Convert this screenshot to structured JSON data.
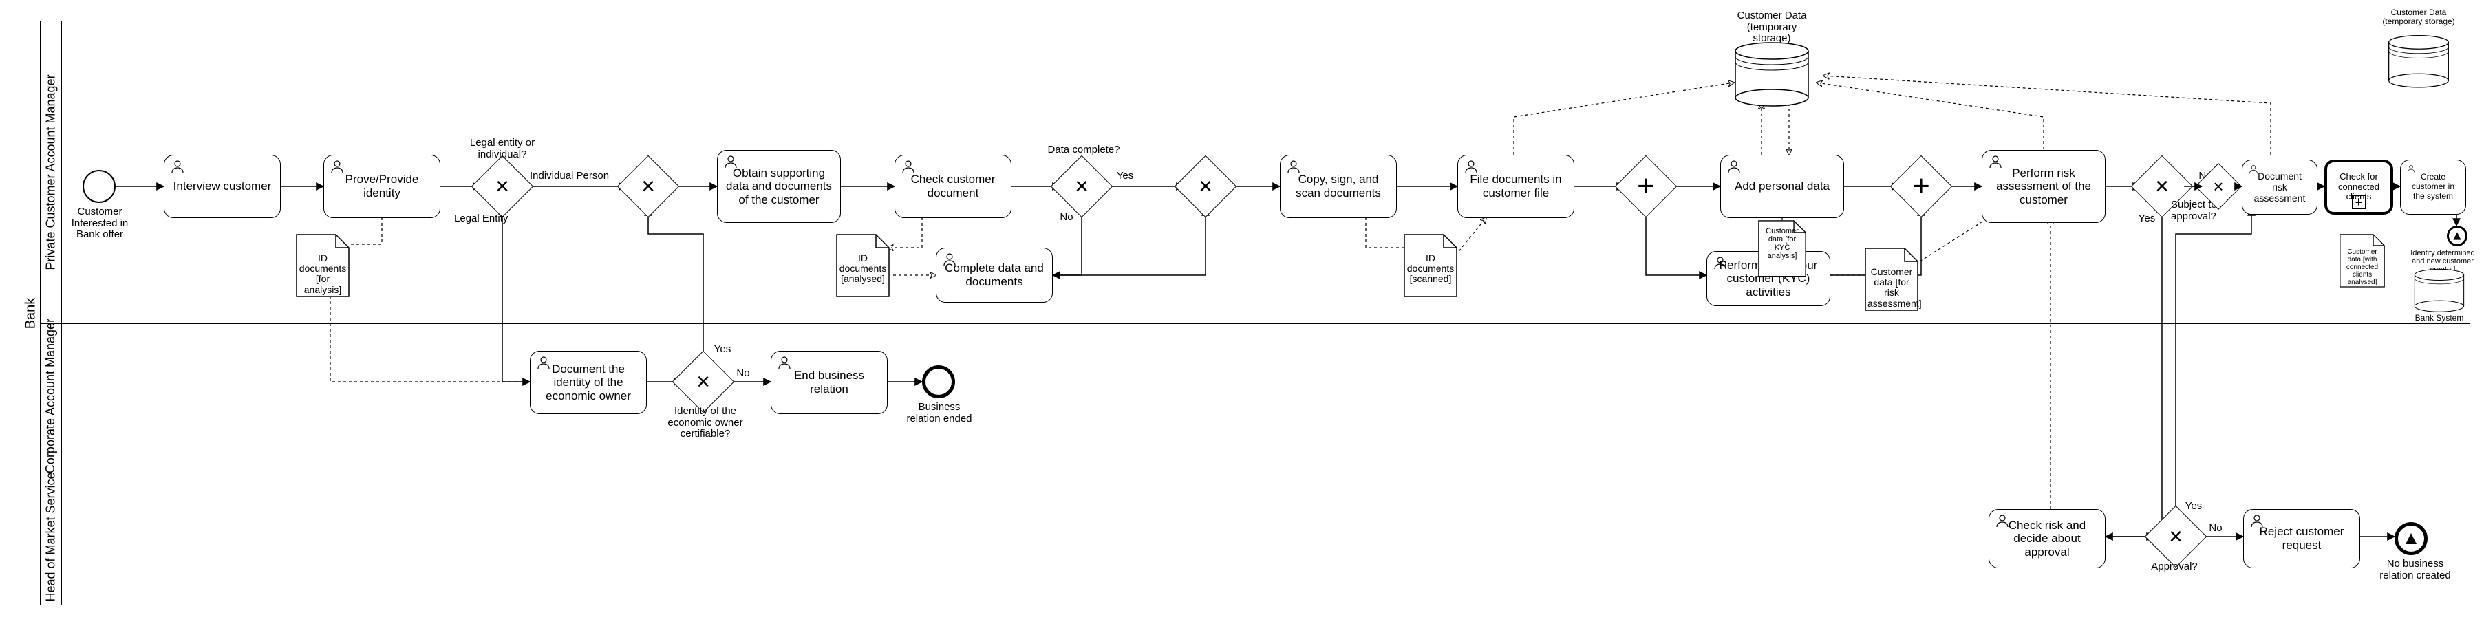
{
  "pool": {
    "name": "Bank"
  },
  "lanes": {
    "l1": "Private Customer Account Manager",
    "l2": "Corporate Account Manager",
    "l3": "Head of Market Service"
  },
  "events": {
    "start": "Customer Interested in Bank offer",
    "end_relation": "Business relation ended",
    "end_identity": "Identity determined and new customer created",
    "end_nobiz": "No business relation created"
  },
  "tasks": {
    "interview": "Interview customer",
    "prove": "Prove/Provide identity",
    "doc_owner": "Document the identity of the economic owner",
    "end_biz": "End business relation",
    "obtain": "Obtain supporting data and documents of the customer",
    "check_doc": "Check customer document",
    "complete": "Complete data and documents",
    "copy": "Copy, sign, and scan documents",
    "file": "File documents in customer file",
    "add_personal": "Add personal data",
    "kyc": "Perform know your customer (KYC) activities",
    "risk": "Perform risk assessment of the customer",
    "doc_risk": "Document risk assessment",
    "check_conn": "Check for connected clients",
    "create_cust": "Create customer in the system",
    "check_risk": "Check risk and decide about approval",
    "reject": "Reject customer request"
  },
  "gateways": {
    "g_entity_label": "Legal entity or individual?",
    "g_entity_ind": "Individual Person",
    "g_entity_leg": "Legal Entity",
    "g_owner_label": "Identity of the economic owner certifiable?",
    "g_owner_yes": "Yes",
    "g_owner_no": "No",
    "g_data_label": "Data complete?",
    "g_data_yes": "Yes",
    "g_data_no": "No",
    "g_subject_label": "Subject to approval?",
    "g_subject_yes": "Yes",
    "g_subject_no": "No",
    "g_approval_label": "Approval?",
    "g_approval_yes": "Yes",
    "g_approval_no": "No"
  },
  "dataobjects": {
    "id_analysis": "ID documents [for analysis]",
    "id_analysed": "ID documents [analysed]",
    "id_scanned": "ID documents [scanned]",
    "cust_kyc": "Customer data [for KYC analysis]",
    "cust_risk": "Customer data [for risk assessment]",
    "cust_conn": "Customer data [with connected clients analysed]"
  },
  "datastores": {
    "temp1": "Customer Data (temporary storage)",
    "temp2": "Customer Data (temporary storage)",
    "bank_sys": "Bank System"
  }
}
